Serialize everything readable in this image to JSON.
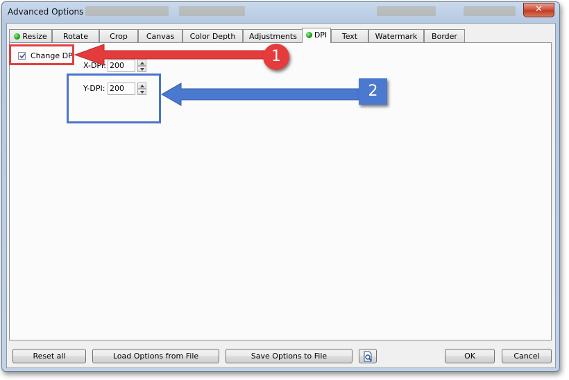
{
  "window": {
    "title": "Advanced Options",
    "close_glyph": "✕"
  },
  "tabs": [
    {
      "label": "Resize",
      "indicator": true
    },
    {
      "label": "Rotate",
      "indicator": false
    },
    {
      "label": "Crop",
      "indicator": false
    },
    {
      "label": "Canvas",
      "indicator": false
    },
    {
      "label": "Color Depth",
      "indicator": false
    },
    {
      "label": "Adjustments",
      "indicator": false
    },
    {
      "label": "DPI",
      "indicator": true,
      "active": true
    },
    {
      "label": "Text",
      "indicator": false
    },
    {
      "label": "Watermark",
      "indicator": false
    },
    {
      "label": "Border",
      "indicator": false
    }
  ],
  "dpi_panel": {
    "change_dpi": {
      "label": "Change DPI",
      "checked": true
    },
    "x_dpi": {
      "label": "X-DPI:",
      "value": "200"
    },
    "y_dpi": {
      "label": "Y-DPI:",
      "value": "200"
    }
  },
  "footer": {
    "reset_label": "Reset all",
    "load_label": "Load Options from File",
    "save_label": "Save Options to File",
    "preview_icon": "document-magnifier-icon",
    "ok_label": "OK",
    "cancel_label": "Cancel"
  },
  "annotations": {
    "callout_1": "1",
    "callout_2": "2",
    "red": "#e43c3c",
    "blue": "#4a79cf"
  },
  "colors": {
    "indicator_green": "#12a214",
    "titlebar": "#b5c9e2",
    "close_red": "#c23b24"
  }
}
